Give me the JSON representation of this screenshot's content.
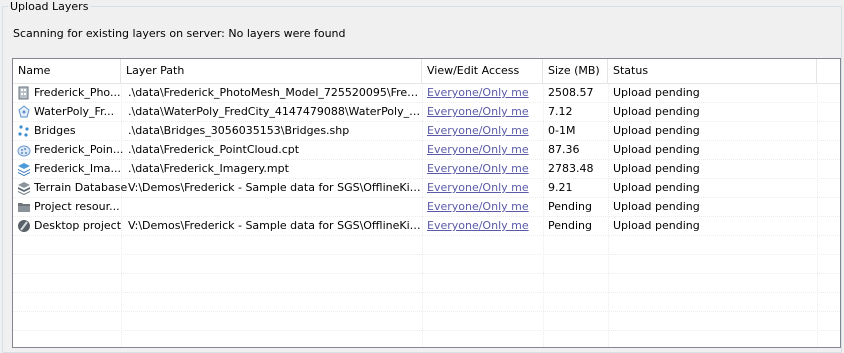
{
  "group": {
    "title": "Upload Layers"
  },
  "status_message": "Scanning for existing layers on server: No layers were found",
  "columns": {
    "name": "Name",
    "path": "Layer Path",
    "access": "View/Edit Access",
    "size": "Size (MB)",
    "status": "Status"
  },
  "rows": [
    {
      "icon": "building-mesh-icon",
      "name": "Frederick_Pho...",
      "path": ".\\data\\Frederick_PhotoMesh_Model_725520095\\Frederic...",
      "access": "Everyone/Only me",
      "size": "2508.57",
      "status": "Upload pending"
    },
    {
      "icon": "polygon-layer-icon",
      "name": "WaterPoly_Fr...",
      "path": ".\\data\\WaterPoly_FredCity_4147479088\\WaterPoly_Fre...",
      "access": "Everyone/Only me",
      "size": "7.12",
      "status": "Upload pending"
    },
    {
      "icon": "point-layer-icon",
      "name": "Bridges",
      "path": ".\\data\\Bridges_3056035153\\Bridges.shp",
      "access": "Everyone/Only me",
      "size": "0-1M",
      "status": "Upload pending"
    },
    {
      "icon": "point-cloud-icon",
      "name": "Frederick_Poin...",
      "path": ".\\data\\Frederick_PointCloud.cpt",
      "access": "Everyone/Only me",
      "size": "87.36",
      "status": "Upload pending"
    },
    {
      "icon": "imagery-layers-icon",
      "name": "Frederick_Ima...",
      "path": ".\\data\\Frederick_Imagery.mpt",
      "access": "Everyone/Only me",
      "size": "2783.48",
      "status": "Upload pending"
    },
    {
      "icon": "terrain-database-icon",
      "name": "Terrain Database",
      "path": "V:\\Demos\\Frederick - Sample data for SGS\\OfflineKit\\Fred...",
      "access": "Everyone/Only me",
      "size": "9.21",
      "status": "Upload pending"
    },
    {
      "icon": "folder-icon",
      "name": "Project resour...",
      "path": "",
      "access": "Everyone/Only me",
      "size": "Pending",
      "status": "Upload pending"
    },
    {
      "icon": "desktop-project-icon",
      "name": "Desktop project",
      "path": "V:\\Demos\\Frederick - Sample data for SGS\\OfflineKit\\Fred...",
      "access": "Everyone/Only me",
      "size": "Pending",
      "status": "Upload pending"
    }
  ]
}
